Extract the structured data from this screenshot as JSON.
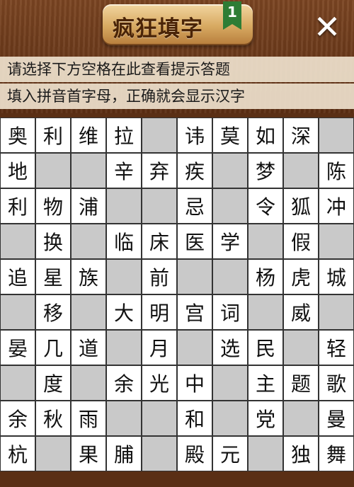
{
  "header": {
    "title": "疯狂填字",
    "level": "1",
    "close_symbol": "✕"
  },
  "hints": [
    "请选择下方空格在此查看提示答题",
    "填入拼音首字母，正确就会显示汉字"
  ],
  "grid": [
    [
      "奥",
      "利",
      "维",
      "拉",
      "",
      "讳",
      "莫",
      "如",
      "深",
      ""
    ],
    [
      "地",
      "",
      "",
      "辛",
      "弃",
      "疾",
      "",
      "梦",
      "",
      "陈"
    ],
    [
      "利",
      "物",
      "浦",
      "",
      "",
      "忌",
      "",
      "令",
      "狐",
      "冲"
    ],
    [
      "",
      "换",
      "",
      "临",
      "床",
      "医",
      "学",
      "",
      "假",
      ""
    ],
    [
      "追",
      "星",
      "族",
      "",
      "前",
      "",
      "",
      "杨",
      "虎",
      "城"
    ],
    [
      "",
      "移",
      "",
      "大",
      "明",
      "宫",
      "词",
      "",
      "威",
      ""
    ],
    [
      "晏",
      "几",
      "道",
      "",
      "月",
      "",
      "选",
      "民",
      "",
      "轻"
    ],
    [
      "",
      "度",
      "",
      "余",
      "光",
      "中",
      "",
      "主",
      "题",
      "歌"
    ],
    [
      "余",
      "秋",
      "雨",
      "",
      "",
      "和",
      "",
      "党",
      "",
      "曼"
    ],
    [
      "杭",
      "",
      "果",
      "脯",
      "",
      "殿",
      "元",
      "",
      "独",
      "舞"
    ]
  ]
}
